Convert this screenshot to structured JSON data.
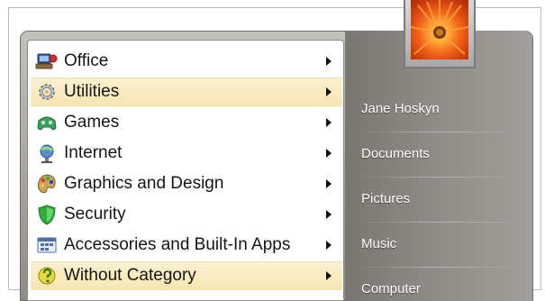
{
  "start_menu": {
    "programs": [
      {
        "label": "Office",
        "icon": "office-icon",
        "highlighted": false
      },
      {
        "label": "Utilities",
        "icon": "utilities-gear-icon",
        "highlighted": true
      },
      {
        "label": "Games",
        "icon": "games-controller-icon",
        "highlighted": false
      },
      {
        "label": "Internet",
        "icon": "internet-globe-icon",
        "highlighted": false
      },
      {
        "label": "Graphics and Design",
        "icon": "palette-icon",
        "highlighted": false
      },
      {
        "label": "Security",
        "icon": "shield-icon",
        "highlighted": false
      },
      {
        "label": "Accessories and Built-In Apps",
        "icon": "accessories-app-icon",
        "highlighted": false
      },
      {
        "label": "Without Category",
        "icon": "without-category-icon",
        "highlighted": true
      }
    ],
    "right_links": [
      {
        "label": "Jane Hoskyn"
      },
      {
        "label": "Documents"
      },
      {
        "label": "Pictures"
      },
      {
        "label": "Music"
      },
      {
        "label": "Computer"
      }
    ]
  },
  "colors": {
    "highlight": "#f7e6b3",
    "right_pane": "#8e8b87",
    "right_text": "#ffffff"
  }
}
